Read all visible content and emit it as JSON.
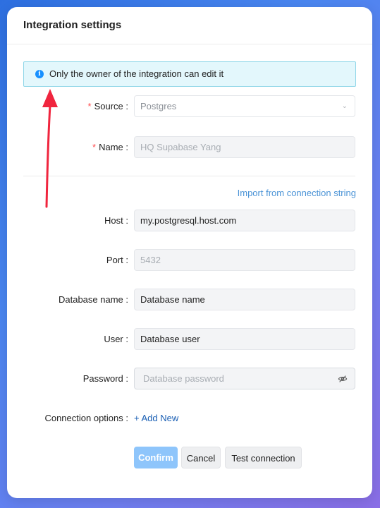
{
  "dialog": {
    "title": "Integration settings"
  },
  "alert": {
    "icon": "info-icon",
    "text": "Only the owner of the integration can edit it"
  },
  "form": {
    "source": {
      "label": "Source",
      "value": "Postgres",
      "required": true
    },
    "name": {
      "label": "Name",
      "placeholder": "HQ Supabase Yang",
      "required": true
    },
    "import_link": "Import from connection string",
    "host": {
      "label": "Host",
      "value": "my.postgresql.host.com"
    },
    "port": {
      "label": "Port",
      "placeholder": "5432"
    },
    "database_name": {
      "label": "Database name",
      "value": "Database name"
    },
    "user": {
      "label": "User",
      "value": "Database user"
    },
    "password": {
      "label": "Password",
      "placeholder": "Database password"
    },
    "connection_options": {
      "label": "Connection options",
      "add_label": "+ Add New"
    }
  },
  "buttons": {
    "confirm": "Confirm",
    "cancel": "Cancel",
    "test": "Test connection"
  },
  "colors": {
    "annotation_arrow": "#f0253e",
    "primary_disabled": "#8ec5fb",
    "link": "#1a5fb4"
  }
}
